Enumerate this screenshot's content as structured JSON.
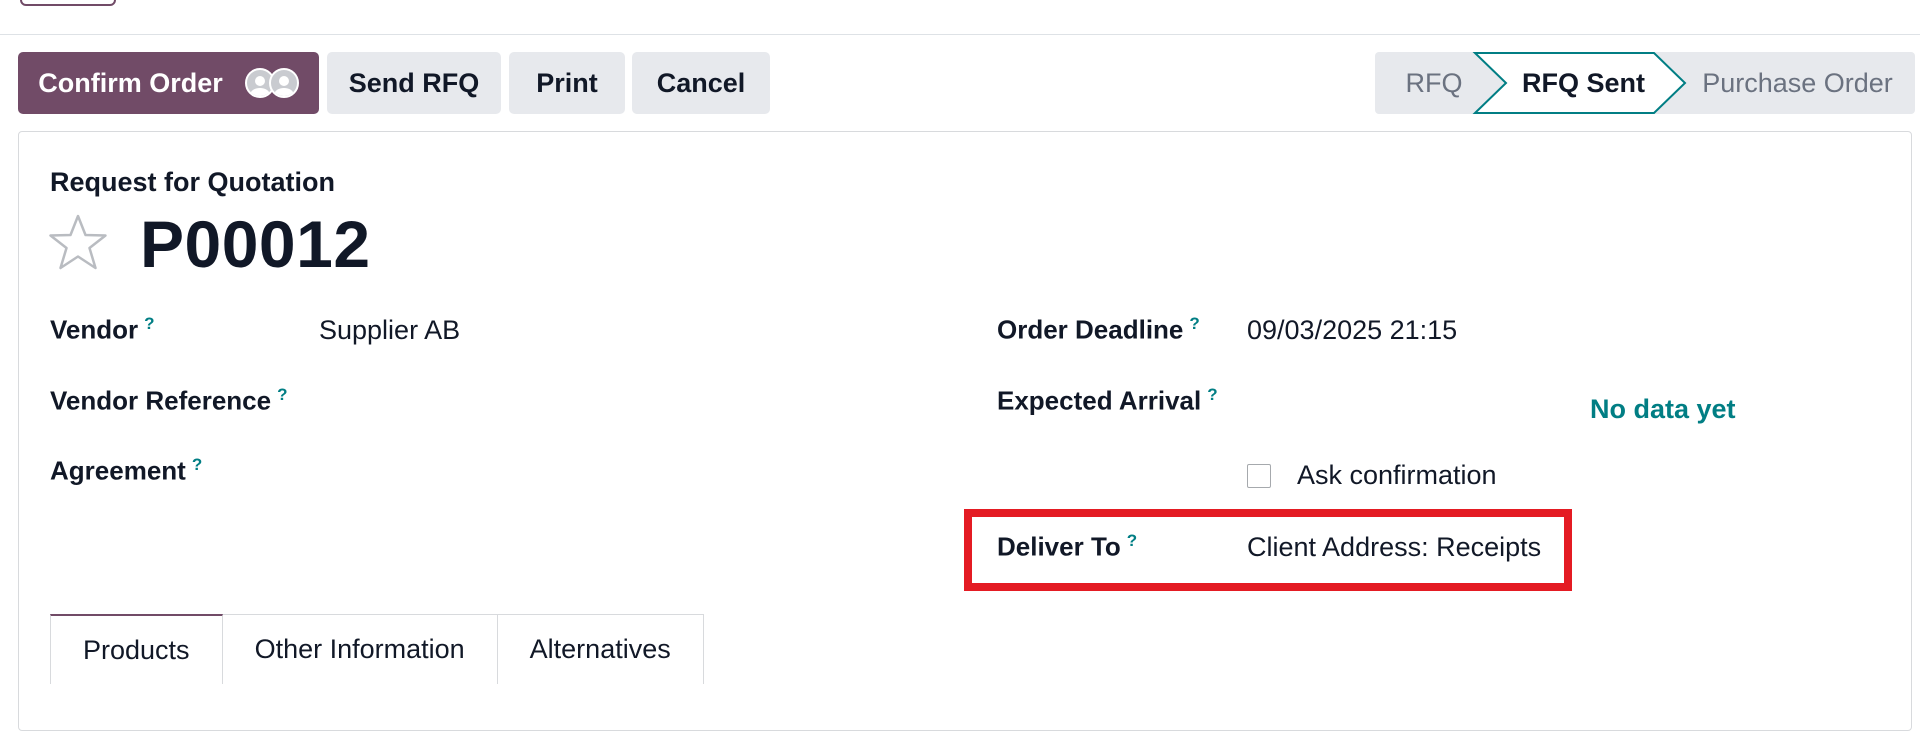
{
  "actions": {
    "confirm_label": "Confirm Order",
    "send_label": "Send RFQ",
    "print_label": "Print",
    "cancel_label": "Cancel"
  },
  "statusbar": {
    "stages": [
      "RFQ",
      "RFQ Sent",
      "Purchase Order"
    ],
    "current": "RFQ Sent"
  },
  "header": {
    "doc_type": "Request for Quotation",
    "doc_name": "P00012"
  },
  "fields": {
    "vendor": {
      "label": "Vendor",
      "value": "Supplier AB"
    },
    "vendor_reference": {
      "label": "Vendor Reference",
      "value": ""
    },
    "agreement": {
      "label": "Agreement",
      "value": ""
    },
    "order_deadline": {
      "label": "Order Deadline",
      "value": "09/03/2025 21:15"
    },
    "expected_arrival": {
      "label": "Expected Arrival",
      "value": ""
    },
    "no_data": "No data yet",
    "ask_confirmation": {
      "label": "Ask confirmation",
      "checked": false
    },
    "deliver_to": {
      "label": "Deliver To",
      "value": "Client Address: Receipts"
    }
  },
  "help_mark": "?",
  "tabs": [
    "Products",
    "Other Information",
    "Alternatives"
  ],
  "colors": {
    "primary": "#714B67",
    "accent": "#017e84",
    "highlight": "#e41b23"
  }
}
